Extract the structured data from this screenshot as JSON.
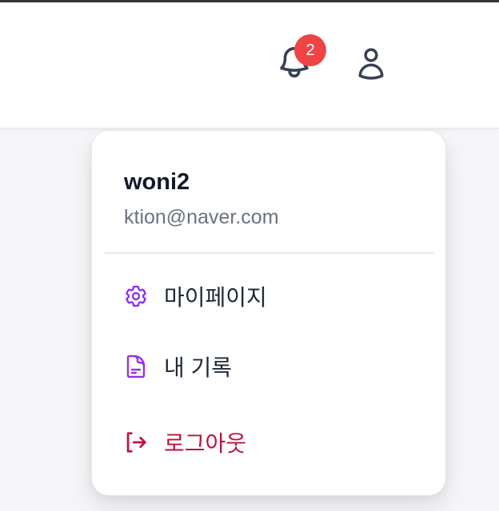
{
  "header": {
    "notifications": {
      "icon": "bell-icon",
      "badge_count": "2",
      "badge_color": "#ef4444"
    },
    "user_icon": "user-icon"
  },
  "dropdown": {
    "user": {
      "name": "woni2",
      "email": "ktion@naver.com"
    },
    "items": [
      {
        "label": "마이페이지",
        "icon": "gear-icon",
        "color": "#9333ea"
      },
      {
        "label": "내 기록",
        "icon": "document-icon",
        "color": "#9333ea"
      },
      {
        "label": "로그아웃",
        "icon": "logout-icon",
        "color": "#be123c"
      }
    ]
  }
}
